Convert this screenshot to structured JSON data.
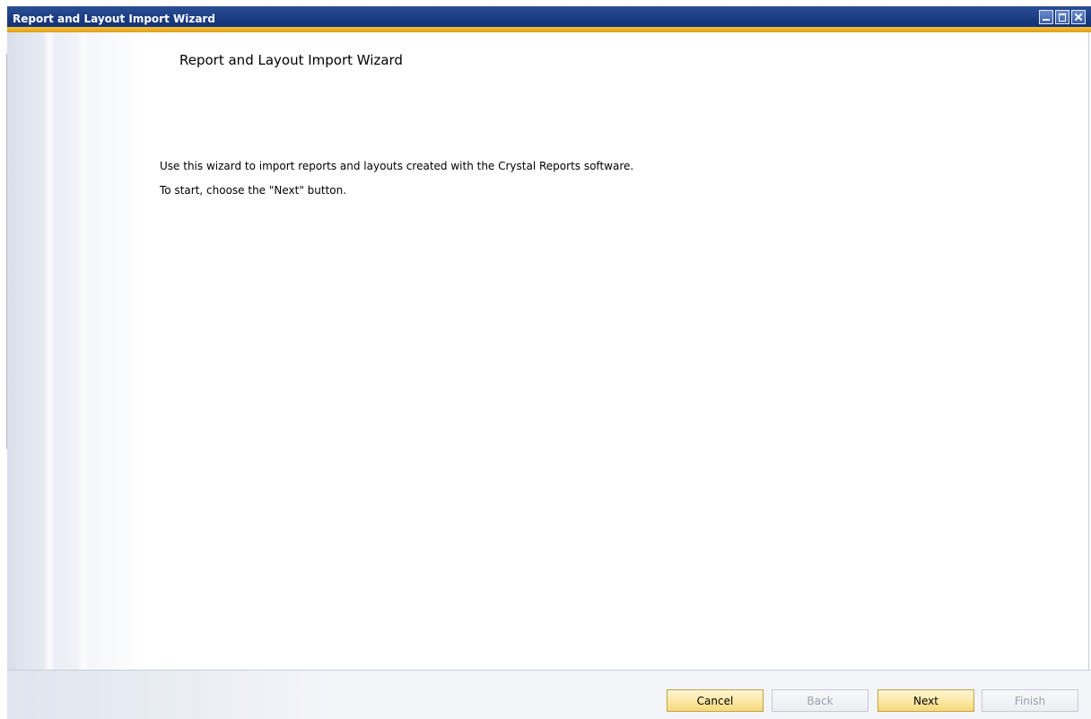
{
  "window": {
    "title": "Report and Layout Import Wizard"
  },
  "wizard": {
    "heading": "Report and Layout Import Wizard",
    "description_line1": "Use this wizard to import reports and layouts created with the Crystal Reports software.",
    "description_line2": "To start, choose the \"Next\" button."
  },
  "footer": {
    "buttons": {
      "cancel": "Cancel",
      "back": "Back",
      "next": "Next",
      "finish": "Finish"
    }
  },
  "colors": {
    "titlebar": "#1a3a80",
    "accent_strip": "#e8a823",
    "button_active": "#fde9a7",
    "button_disabled_text": "#9aa0a8"
  }
}
